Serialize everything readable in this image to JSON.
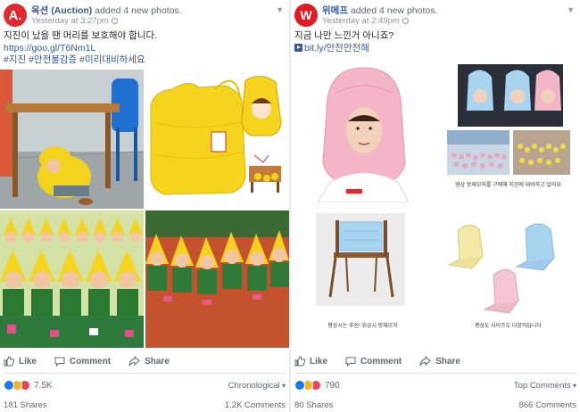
{
  "posts": [
    {
      "avatar_letter": "A.",
      "page_name": "옥션 (Auction)",
      "action_text": "added 4 new photos.",
      "timestamp": "Yesterday at 3:27pm",
      "text_line1": "지진이 났을 땐 머리를 보호해야 합니다.",
      "link": "https://goo.gl/T6Nm1L",
      "hashtags": "#지진 #안전불감증 #미리대비하세요",
      "like_label": "Like",
      "comment_label": "Comment",
      "share_label": "Share",
      "reaction_count": "7.5K",
      "sort_label": "Chronological",
      "shares_text": "181 Shares",
      "comments_text": "1.2K Comments"
    },
    {
      "avatar_letter": "W",
      "page_name": "위메프",
      "action_text": "added 4 new photos.",
      "timestamp": "Yesterday at 2:49pm",
      "text_line1": "지금 나만 느낀거 아니죠?",
      "link": "bit.ly/안전안전해",
      "like_label": "Like",
      "comment_label": "Comment",
      "share_label": "Share",
      "reaction_count": "790",
      "sort_label": "Top Comments",
      "shares_text": "80 Shares",
      "comments_text": "866 Comments",
      "photo_captions": {
        "school": "영상 방재모자를 구매해 지진에 대비하고 있어요",
        "chair": "평상시는 푸쉰! 위급시 방재모자",
        "hoods": "평상도 사이즈도 다양하답니다"
      }
    }
  ],
  "colors": {
    "link": "#365899",
    "secondary": "#616770",
    "hood_yellow": "#f3d21b",
    "hood_pink": "#f4b6c6",
    "hood_blue": "#a9d4ef"
  }
}
